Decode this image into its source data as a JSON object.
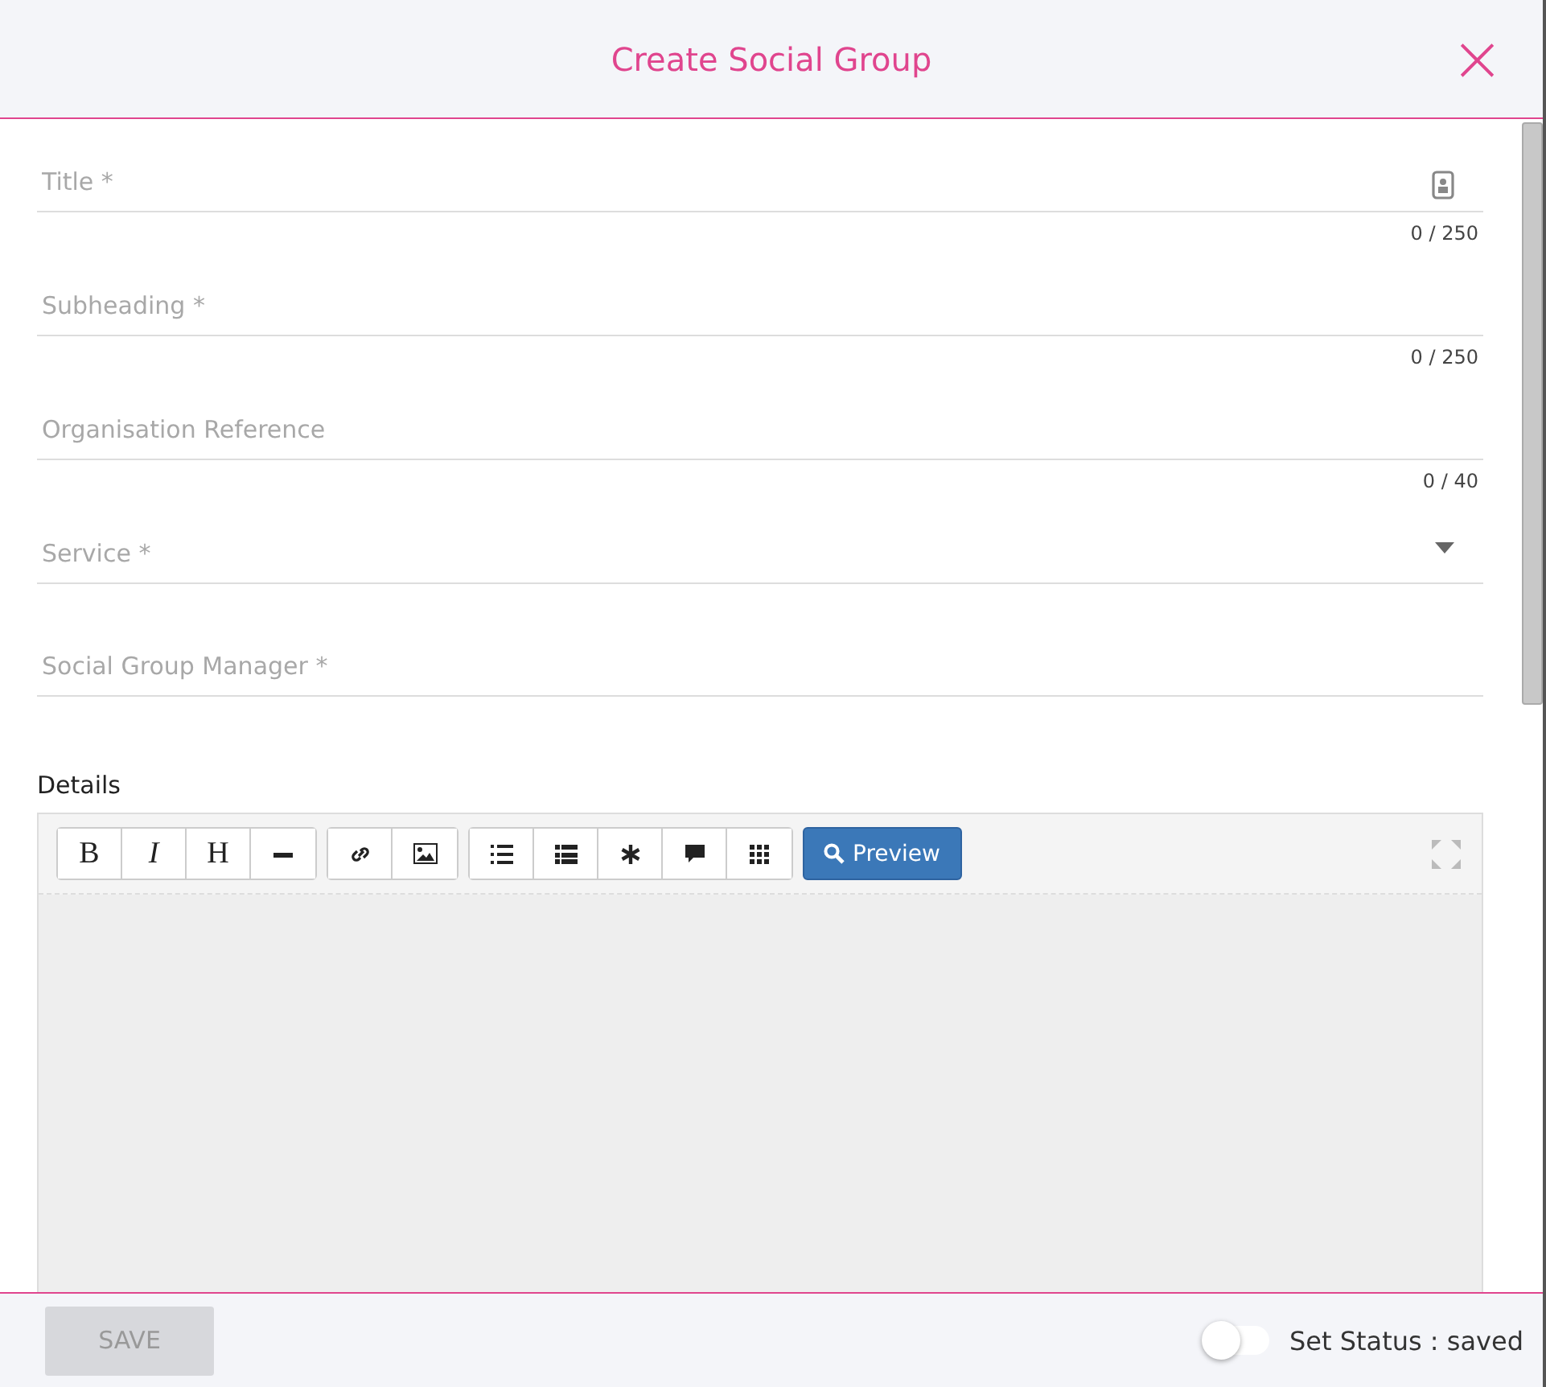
{
  "dialog": {
    "title": "Create Social Group",
    "close": "×"
  },
  "fields": [
    {
      "kind": "text",
      "placeholder": "Title *",
      "counter": "0 / 250",
      "has_icon": true
    },
    {
      "kind": "text",
      "placeholder": "Subheading *",
      "counter": "0 / 250",
      "has_icon": false
    },
    {
      "kind": "text",
      "placeholder": "Organisation Reference",
      "counter": "0 / 40",
      "has_icon": false
    },
    {
      "kind": "select",
      "placeholder": "Service *",
      "has_icon": false
    },
    {
      "kind": "text",
      "placeholder": "Social Group Manager *",
      "has_icon": false
    }
  ],
  "details": {
    "label": "Details",
    "toolbar": [
      [
        {
          "kind": "bold",
          "label": "B"
        },
        {
          "kind": "italic",
          "label": "I"
        },
        {
          "kind": "heading",
          "label": "H"
        },
        {
          "kind": "rule"
        }
      ],
      [
        {
          "kind": "link"
        },
        {
          "kind": "image"
        }
      ],
      [
        {
          "kind": "ordered-list"
        },
        {
          "kind": "bullet-list"
        },
        {
          "kind": "asterisk"
        },
        {
          "kind": "comment"
        },
        {
          "kind": "grid"
        }
      ]
    ],
    "preview": "Preview"
  },
  "footer": {
    "save": "SAVE",
    "save_disabled": true,
    "status_label": "Set Status : saved",
    "status_on": false
  }
}
